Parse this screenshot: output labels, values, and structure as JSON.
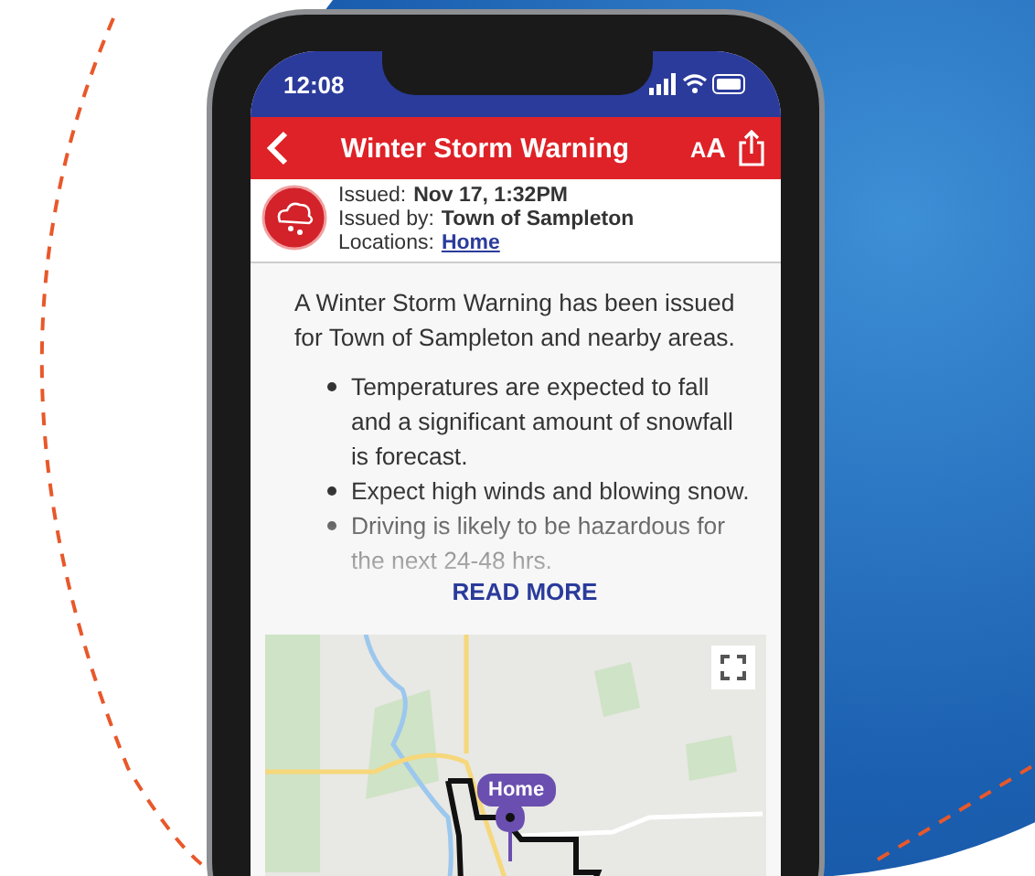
{
  "status_bar": {
    "time": "12:08"
  },
  "header": {
    "title": "Winter Storm Warning",
    "text_size_button": "AA"
  },
  "alert_info": {
    "issued_label": "Issued:",
    "issued_value": "Nov 17, 1:32PM",
    "issued_by_label": "Issued by:",
    "issued_by_value": "Town of Sampleton",
    "locations_label": "Locations:",
    "location_link": "Home"
  },
  "body": {
    "intro": "A Winter Storm Warning has been issued for Town of Sampleton and nearby areas.",
    "bullets": [
      "Temperatures are expected to fall and a significant amount of snowfall is forecast.",
      "Expect high winds and blowing snow.",
      "Driving is likely to be hazardous for the next 24-48 hrs."
    ],
    "read_more": "READ MORE"
  },
  "map": {
    "marker_label": "Home"
  }
}
